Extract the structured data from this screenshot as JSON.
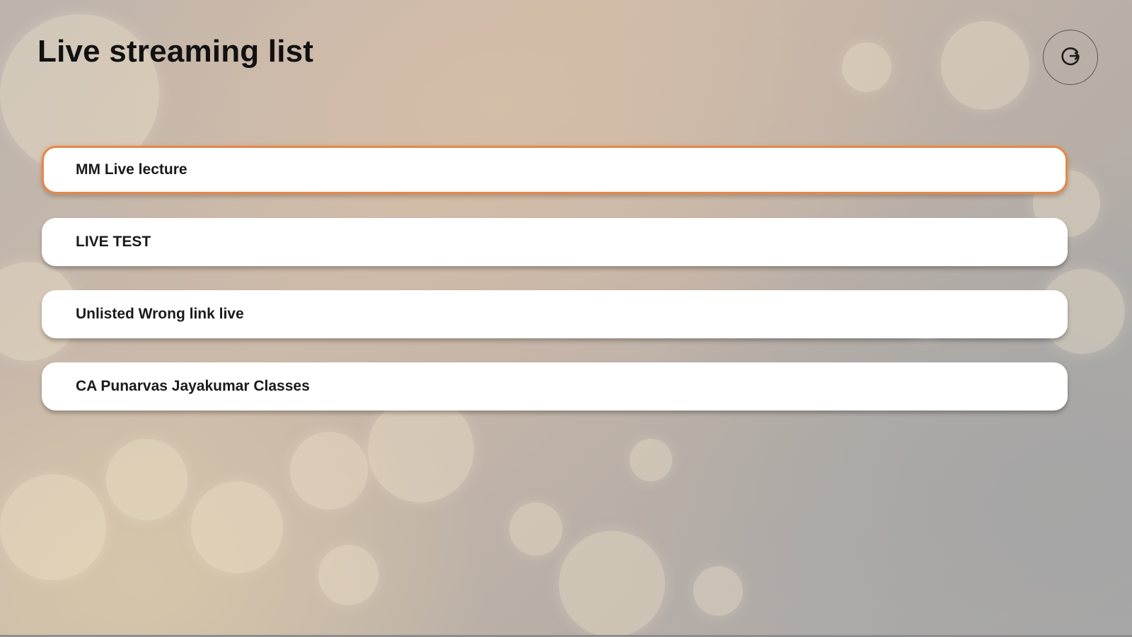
{
  "header": {
    "title": "Live streaming list",
    "refresh_icon": "refresh-icon"
  },
  "streams": [
    {
      "label": "MM Live lecture",
      "selected": true
    },
    {
      "label": "LIVE TEST",
      "selected": false
    },
    {
      "label": "Unlisted Wrong link live",
      "selected": false
    },
    {
      "label": "CA Punarvas Jayakumar Classes",
      "selected": false
    }
  ],
  "colors": {
    "accent": "#e08a4e",
    "card": "#ffffff",
    "text": "#111111"
  }
}
